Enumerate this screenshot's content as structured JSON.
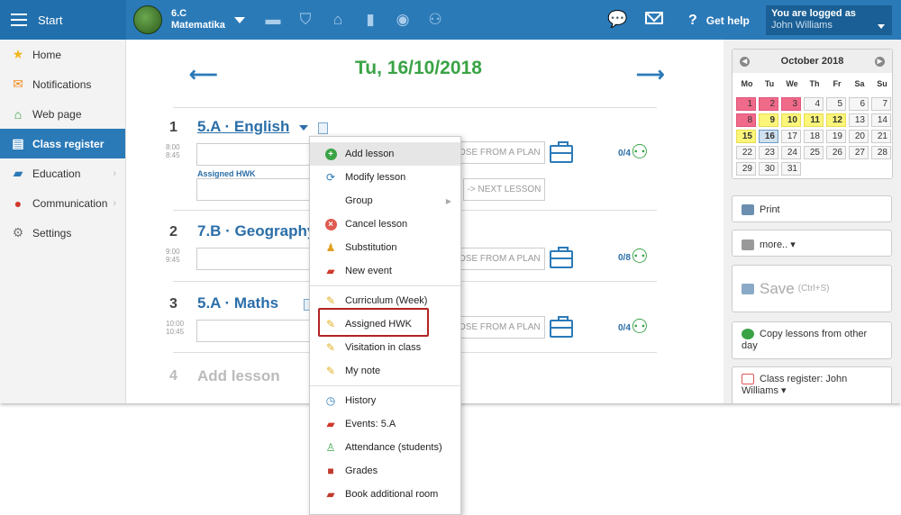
{
  "topbar": {
    "start_label": "Start",
    "class_code": "6.C",
    "class_subject": "Matematika",
    "help_label": "Get help",
    "logged_label": "You are logged as",
    "user_name": "John Williams"
  },
  "sidebar": {
    "items": [
      {
        "label": "Home",
        "icon": "star-icon"
      },
      {
        "label": "Notifications",
        "icon": "envelope-icon"
      },
      {
        "label": "Web page",
        "icon": "house-icon"
      },
      {
        "label": "Class register",
        "icon": "register-icon"
      },
      {
        "label": "Education",
        "icon": "book-icon"
      },
      {
        "label": "Communication",
        "icon": "chat-icon"
      },
      {
        "label": "Settings",
        "icon": "gear-icon"
      }
    ]
  },
  "main": {
    "date": "Tu, 16/10/2018",
    "assigned_hwk_label": "Assigned HWK",
    "plan_label": "OSE FROM A PLAN",
    "next_lesson_label": "-> NEXT LESSON",
    "lessons": [
      {
        "num": "1",
        "title": "5.A · English",
        "time_start": "8:00",
        "time_end": "8:45",
        "count": "0/4"
      },
      {
        "num": "2",
        "title": "7.B · Geography",
        "time_start": "9:00",
        "time_end": "9:45",
        "count": "0/8"
      },
      {
        "num": "3",
        "title": "5.A · Maths",
        "time_start": "10:00",
        "time_end": "10:45",
        "count": "0/4"
      },
      {
        "num": "4",
        "title": "Add lesson"
      }
    ]
  },
  "calendar": {
    "month": "October 2018",
    "dow": [
      "Mo",
      "Tu",
      "We",
      "Th",
      "Fr",
      "Sa",
      "Su"
    ],
    "weeks": [
      [
        "1",
        "2",
        "3",
        "4",
        "5",
        "6",
        "7"
      ],
      [
        "8",
        "9",
        "10",
        "11",
        "12",
        "13",
        "14"
      ],
      [
        "15",
        "16",
        "17",
        "18",
        "19",
        "20",
        "21"
      ],
      [
        "22",
        "23",
        "24",
        "25",
        "26",
        "27",
        "28"
      ],
      [
        "29",
        "30",
        "31",
        "",
        "",
        "",
        ""
      ]
    ]
  },
  "right": {
    "print_label": "Print",
    "more_label": "more.. ▾",
    "save_label": "Save",
    "save_hint": "(Ctrl+S)",
    "copy_label": "Copy lessons from other day",
    "register_label": "Class register: John Williams ▾"
  },
  "menu": {
    "items": [
      {
        "label": "Add lesson",
        "icon": "plus-circle-icon"
      },
      {
        "label": "Modify lesson",
        "icon": "refresh-icon"
      },
      {
        "label": "Group",
        "icon": ""
      },
      {
        "label": "Cancel lesson",
        "icon": "cancel-circle-icon"
      },
      {
        "label": "Substitution",
        "icon": "substitution-icon"
      },
      {
        "label": "New event",
        "icon": "event-icon"
      },
      {
        "label": "Curriculum (Week)",
        "icon": "pencil-icon"
      },
      {
        "label": "Assigned HWK",
        "icon": "pencil-icon"
      },
      {
        "label": "Visitation in class",
        "icon": "pencil-icon"
      },
      {
        "label": "My note",
        "icon": "pencil-icon"
      },
      {
        "label": "History",
        "icon": "clock-icon"
      },
      {
        "label": "Events: 5.A",
        "icon": "event-icon"
      },
      {
        "label": "Attendance (students)",
        "icon": "person-icon"
      },
      {
        "label": "Grades",
        "icon": "grades-icon"
      },
      {
        "label": "Book additional room",
        "icon": "room-icon"
      }
    ]
  },
  "colors": {
    "topbar": "#2b7ab8",
    "accent_green": "#3aa346",
    "highlight": "#b22222"
  }
}
